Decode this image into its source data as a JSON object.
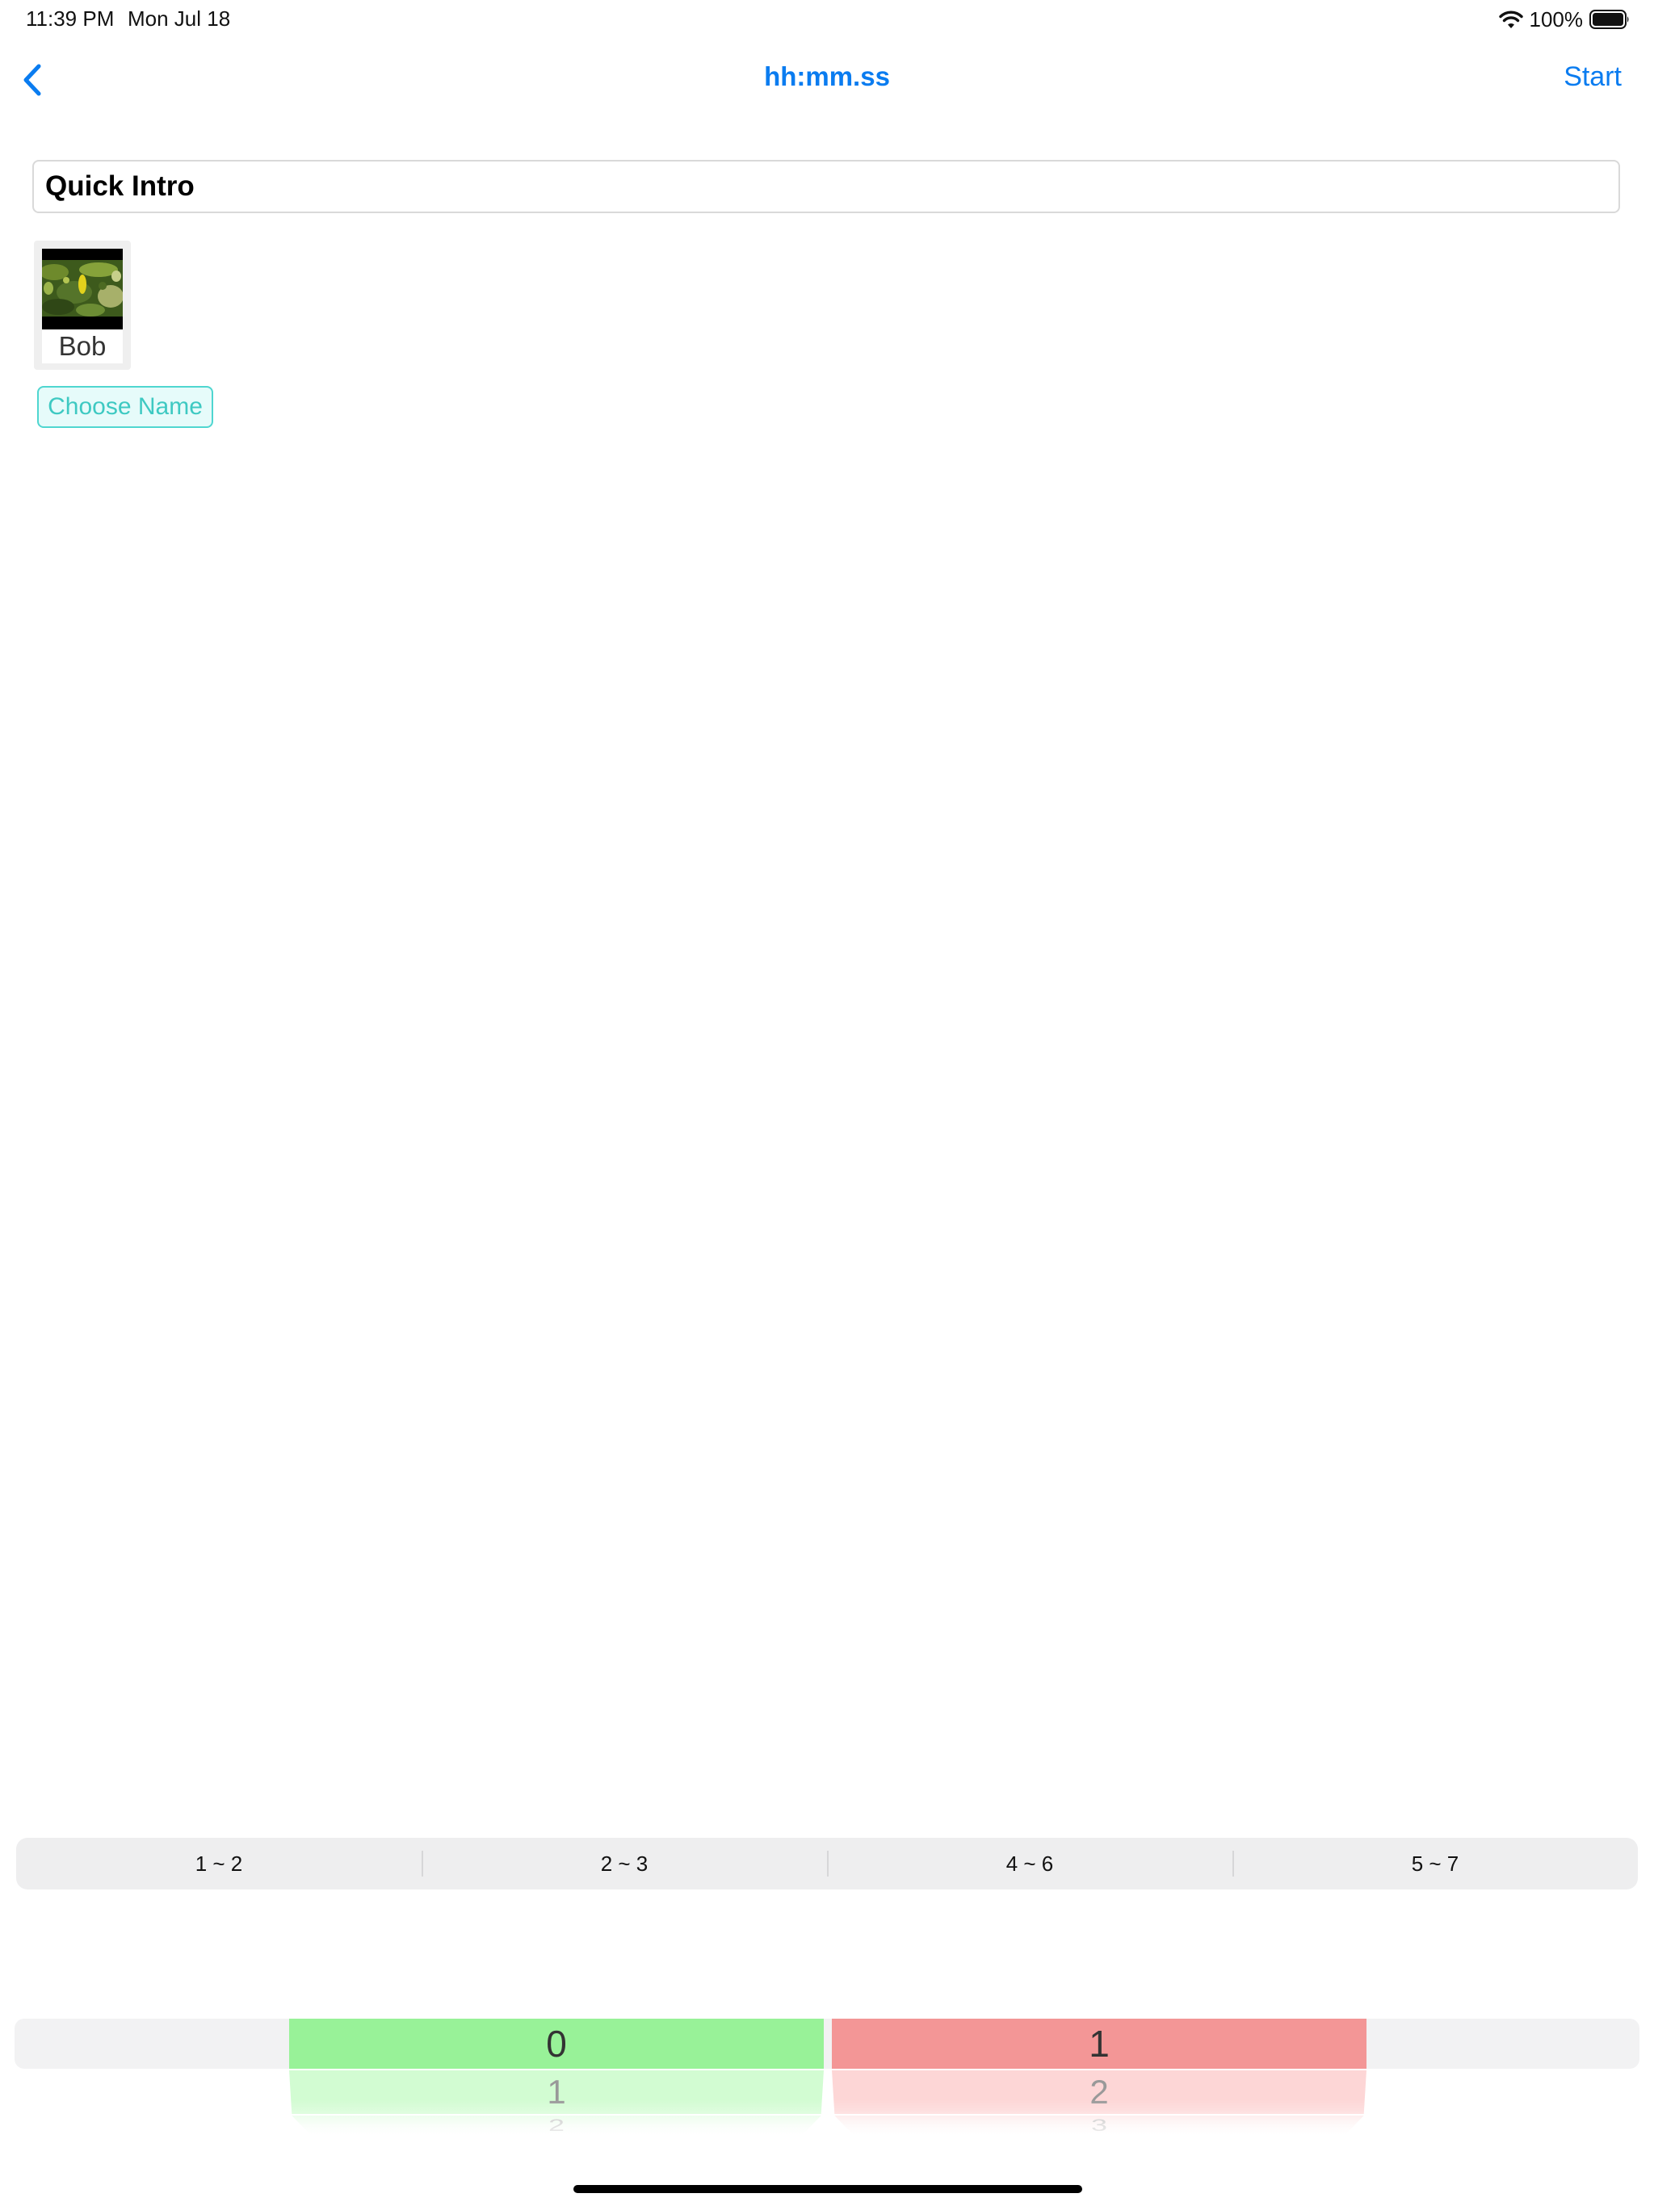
{
  "status_bar": {
    "time": "11:39 PM",
    "date": "Mon Jul 18",
    "battery": "100%",
    "wifi_icon": "wifi-icon",
    "battery_icon": "battery-full-icon"
  },
  "nav": {
    "back_icon": "chevron-left-icon",
    "title": "hh:mm.ss",
    "start_label": "Start",
    "accent_color": "#0a7cf0"
  },
  "main": {
    "title_value": "Quick Intro",
    "participant": {
      "name": "Bob",
      "photo": "participant-photo"
    },
    "choose_name_label": "Choose Name",
    "choose_name_color": "#3ec9c2"
  },
  "segmented": {
    "segments": [
      "1 ~ 2",
      "2 ~ 3",
      "4 ~ 6",
      "5 ~ 7"
    ]
  },
  "picker": {
    "left": {
      "selected": "0",
      "next": "1",
      "after": "2",
      "color": "#98f298"
    },
    "right": {
      "selected": "1",
      "next": "2",
      "after": "3",
      "color": "#f39696"
    }
  }
}
